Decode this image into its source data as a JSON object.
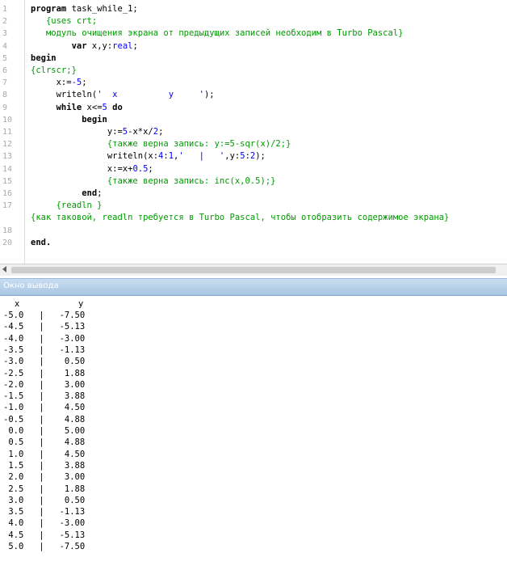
{
  "editor": {
    "lines": [
      {
        "num": "1",
        "parts": [
          {
            "t": "program ",
            "c": "kw"
          },
          {
            "t": "task_while_1;",
            "c": ""
          }
        ]
      },
      {
        "num": "2",
        "parts": [
          {
            "t": "   {uses crt;",
            "c": "cm"
          }
        ]
      },
      {
        "num": "3",
        "parts": [
          {
            "t": "   модуль очищения экрана от предыдущих записей необходим в Turbo Pascal}",
            "c": "cm"
          }
        ]
      },
      {
        "num": "4",
        "parts": [
          {
            "t": "        ",
            "c": ""
          },
          {
            "t": "var ",
            "c": "kw"
          },
          {
            "t": "x,y:",
            "c": ""
          },
          {
            "t": "real",
            "c": "str"
          },
          {
            "t": ";",
            "c": ""
          }
        ]
      },
      {
        "num": "5",
        "parts": [
          {
            "t": "begin",
            "c": "kw"
          }
        ]
      },
      {
        "num": "6",
        "parts": [
          {
            "t": "{clrscr;}",
            "c": "cm"
          }
        ]
      },
      {
        "num": "7",
        "parts": [
          {
            "t": "     x:=",
            "c": ""
          },
          {
            "t": "-5",
            "c": "num"
          },
          {
            "t": ";",
            "c": ""
          }
        ]
      },
      {
        "num": "8",
        "parts": [
          {
            "t": "     writeln(",
            "c": ""
          },
          {
            "t": "'  x          y     '",
            "c": "str"
          },
          {
            "t": ");",
            "c": ""
          }
        ]
      },
      {
        "num": "9",
        "parts": [
          {
            "t": "     ",
            "c": ""
          },
          {
            "t": "while ",
            "c": "kw"
          },
          {
            "t": "x<=",
            "c": ""
          },
          {
            "t": "5",
            "c": "num"
          },
          {
            "t": " ",
            "c": ""
          },
          {
            "t": "do",
            "c": "kw"
          }
        ]
      },
      {
        "num": "10",
        "parts": [
          {
            "t": "          ",
            "c": ""
          },
          {
            "t": "begin",
            "c": "kw"
          }
        ]
      },
      {
        "num": "11",
        "parts": [
          {
            "t": "               y:=",
            "c": ""
          },
          {
            "t": "5",
            "c": "num"
          },
          {
            "t": "-x*x/",
            "c": ""
          },
          {
            "t": "2",
            "c": "num"
          },
          {
            "t": ";",
            "c": ""
          }
        ]
      },
      {
        "num": "12",
        "parts": [
          {
            "t": "               {также верна запись: y:=5-sqr(x)/2;}",
            "c": "cm"
          }
        ]
      },
      {
        "num": "13",
        "parts": [
          {
            "t": "               writeln(x:",
            "c": ""
          },
          {
            "t": "4",
            "c": "num"
          },
          {
            "t": ":",
            "c": ""
          },
          {
            "t": "1",
            "c": "num"
          },
          {
            "t": ",",
            "c": ""
          },
          {
            "t": "'   |   '",
            "c": "str"
          },
          {
            "t": ",y:",
            "c": ""
          },
          {
            "t": "5",
            "c": "num"
          },
          {
            "t": ":",
            "c": ""
          },
          {
            "t": "2",
            "c": "num"
          },
          {
            "t": ");",
            "c": ""
          }
        ]
      },
      {
        "num": "14",
        "parts": [
          {
            "t": "               x:=x+",
            "c": ""
          },
          {
            "t": "0.5",
            "c": "num"
          },
          {
            "t": ";",
            "c": ""
          }
        ]
      },
      {
        "num": "15",
        "parts": [
          {
            "t": "               {также верна запись: inc(x,0.5);}",
            "c": "cm"
          }
        ]
      },
      {
        "num": "16",
        "parts": [
          {
            "t": "          ",
            "c": ""
          },
          {
            "t": "end",
            "c": "kw"
          },
          {
            "t": ";",
            "c": ""
          }
        ]
      },
      {
        "num": "17",
        "parts": [
          {
            "t": "     {readln }",
            "c": "cm"
          }
        ]
      },
      {
        "num": "",
        "parts": [
          {
            "t": "{как таковой, readln требуется в Turbo Pascal, чтобы отобразить содержимое экрана}",
            "c": "cm"
          }
        ]
      },
      {
        "num": "18",
        "parts": []
      },
      {
        "num": "20",
        "parts": [
          {
            "t": "end.",
            "c": "kw"
          }
        ]
      }
    ]
  },
  "output_panel": {
    "title": "Окно вывода",
    "header_x": "x",
    "header_y": "y",
    "separator": "|",
    "rows": [
      {
        "x": "-5.0",
        "y": "-7.50"
      },
      {
        "x": "-4.5",
        "y": "-5.13"
      },
      {
        "x": "-4.0",
        "y": "-3.00"
      },
      {
        "x": "-3.5",
        "y": "-1.13"
      },
      {
        "x": "-3.0",
        "y": "0.50"
      },
      {
        "x": "-2.5",
        "y": "1.88"
      },
      {
        "x": "-2.0",
        "y": "3.00"
      },
      {
        "x": "-1.5",
        "y": "3.88"
      },
      {
        "x": "-1.0",
        "y": "4.50"
      },
      {
        "x": "-0.5",
        "y": "4.88"
      },
      {
        "x": "0.0",
        "y": "5.00"
      },
      {
        "x": "0.5",
        "y": "4.88"
      },
      {
        "x": "1.0",
        "y": "4.50"
      },
      {
        "x": "1.5",
        "y": "3.88"
      },
      {
        "x": "2.0",
        "y": "3.00"
      },
      {
        "x": "2.5",
        "y": "1.88"
      },
      {
        "x": "3.0",
        "y": "0.50"
      },
      {
        "x": "3.5",
        "y": "-1.13"
      },
      {
        "x": "4.0",
        "y": "-3.00"
      },
      {
        "x": "4.5",
        "y": "-5.13"
      },
      {
        "x": "5.0",
        "y": "-7.50"
      }
    ]
  }
}
